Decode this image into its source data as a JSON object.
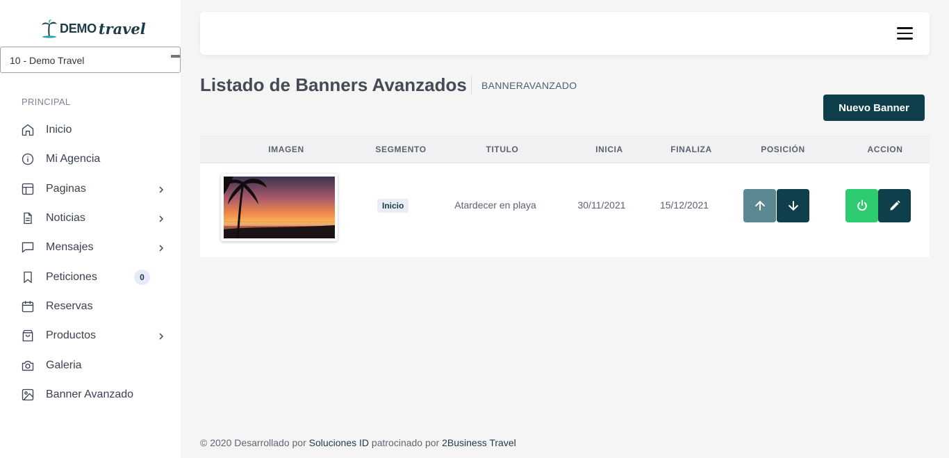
{
  "brand": {
    "logo_text_1": "DEMO",
    "logo_text_2": "travel"
  },
  "agency_select": {
    "value": "10 - Demo Travel"
  },
  "sidebar": {
    "section_label": "PRINCIPAL",
    "items": [
      {
        "label": "Inicio",
        "icon": "home-icon"
      },
      {
        "label": "Mi Agencia",
        "icon": "info-icon"
      },
      {
        "label": "Paginas",
        "icon": "layout-icon",
        "chevron": true
      },
      {
        "label": "Noticias",
        "icon": "file-text-icon",
        "chevron": true
      },
      {
        "label": "Mensajes",
        "icon": "message-square-icon",
        "chevron": true
      },
      {
        "label": "Peticiones",
        "icon": "bookmark-icon",
        "badge": "0"
      },
      {
        "label": "Reservas",
        "icon": "calendar-icon"
      },
      {
        "label": "Productos",
        "icon": "shopping-bag-icon",
        "chevron": true
      },
      {
        "label": "Galeria",
        "icon": "camera-icon"
      },
      {
        "label": "Banner Avanzado",
        "icon": "image-icon"
      }
    ]
  },
  "header": {
    "page_title": "Listado de Banners Avanzados",
    "breadcrumb": "BANNERAVANZADO",
    "new_button": "Nuevo Banner"
  },
  "table": {
    "columns": [
      "IMAGEN",
      "SEGMENTO",
      "TITULO",
      "INICIA",
      "FINALIZA",
      "POSICIÓN",
      "ACCION"
    ],
    "rows": [
      {
        "image": "sunset-beach-thumbnail",
        "segment": "Inicio",
        "title": "Atardecer en playa",
        "start": "30/11/2021",
        "end": "15/12/2021"
      }
    ]
  },
  "colors": {
    "primary": "#0f3f4a",
    "up_button": "#5b8891",
    "power_button": "#2ecc71"
  },
  "footer": {
    "prefix": "© 2020 Desarrollado por",
    "developer": "Soluciones ID",
    "middle": "patrocinado por",
    "sponsor": "2Business Travel"
  }
}
